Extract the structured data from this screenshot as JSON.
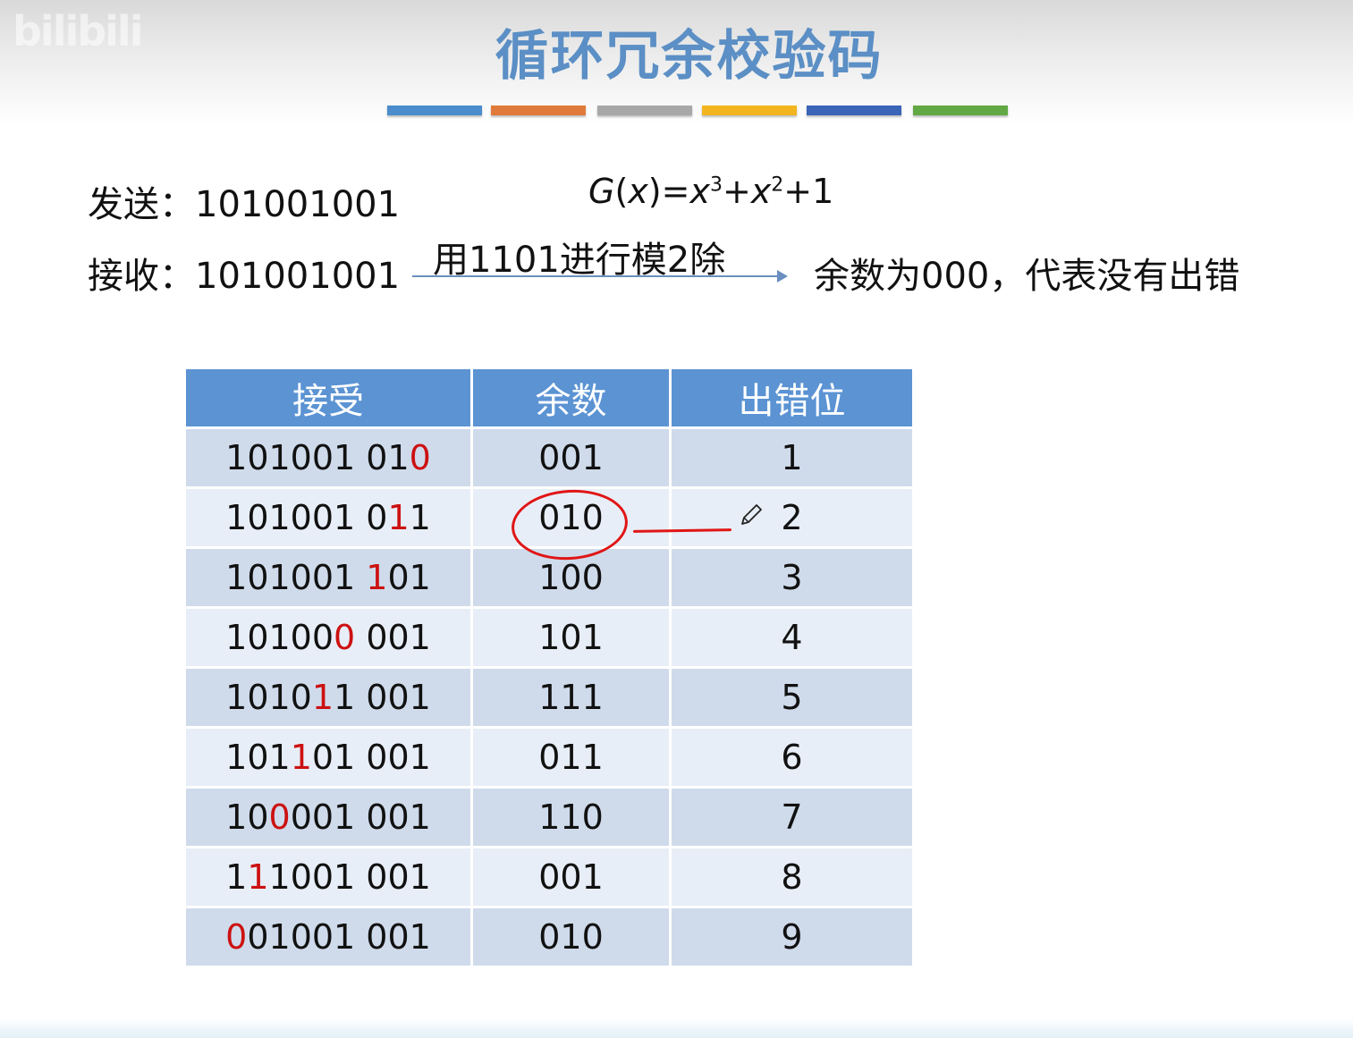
{
  "watermark": "bilibili",
  "title": "循环冗余校验码",
  "colors": [
    "#4a8ccc",
    "#e07a3a",
    "#a8a8a8",
    "#f3b51f",
    "#3a64b8",
    "#62a844"
  ],
  "send": {
    "label": "发送：",
    "value": "101001001"
  },
  "receive": {
    "label": "接收：",
    "value": "101001001"
  },
  "formula": {
    "g": "G",
    "x": "x",
    "text_eq": "=",
    "x3": "x",
    "exp3": "3",
    "plus1": "+",
    "x2": "x",
    "exp2": "2",
    "tail": "+1"
  },
  "arrow_label": "用1101进行模2除",
  "result": "余数为000，代表没有出错",
  "table": {
    "headers": [
      "接受",
      "余数",
      "出错位"
    ],
    "rows": [
      {
        "pre": "101001 01",
        "err": "0",
        "post": "",
        "remainder": "001",
        "pos": "1"
      },
      {
        "pre": "101001 0",
        "err": "1",
        "post": "1",
        "remainder": "010",
        "pos": "2"
      },
      {
        "pre": "101001 ",
        "err": "1",
        "post": "01",
        "remainder": "100",
        "pos": "3"
      },
      {
        "pre": "10100",
        "err": "0",
        "post": " 001",
        "remainder": "101",
        "pos": "4"
      },
      {
        "pre": "1010",
        "err": "1",
        "post": "1 001",
        "remainder": "111",
        "pos": "5"
      },
      {
        "pre": "101",
        "err": "1",
        "post": "01 001",
        "remainder": "011",
        "pos": "6"
      },
      {
        "pre": "10",
        "err": "0",
        "post": "001 001",
        "remainder": "110",
        "pos": "7"
      },
      {
        "pre": "1",
        "err": "1",
        "post": "1001 001",
        "remainder": "001",
        "pos": "8"
      },
      {
        "pre": "",
        "err": "0",
        "post": "01001 001",
        "remainder": "010",
        "pos": "9"
      }
    ]
  },
  "annotation_icon": "pencil-icon"
}
